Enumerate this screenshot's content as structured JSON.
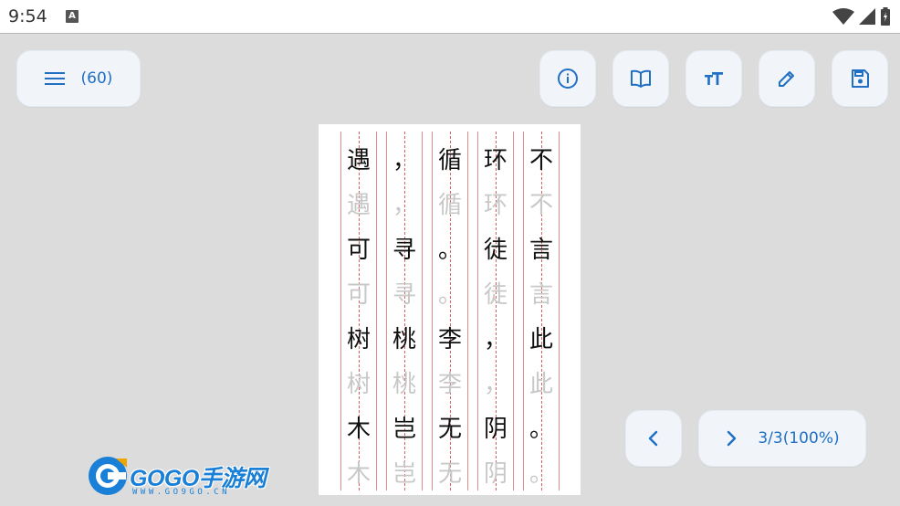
{
  "status_bar": {
    "time": "9:54",
    "notification_icon_letter": "A",
    "icons": [
      "wifi-icon",
      "signal-icon",
      "battery-icon"
    ]
  },
  "toolbar": {
    "menu_count": "(60)",
    "icons": [
      "info-icon",
      "book-icon",
      "font-size-icon",
      "edit-pencil-icon",
      "save-icon"
    ],
    "accent_color": "#1f6fc4"
  },
  "pager": {
    "prev_icon": "chevron-left-icon",
    "next_icon": "chevron-right-icon",
    "progress": "3/3(100%)"
  },
  "worksheet": {
    "columns": [
      {
        "chars": [
          "遇",
          "可",
          "树",
          "木"
        ]
      },
      {
        "chars": [
          "，",
          "寻",
          "桃",
          "岂"
        ]
      },
      {
        "chars": [
          "循",
          "。",
          "李",
          "无"
        ]
      },
      {
        "chars": [
          "环",
          "徒",
          "，",
          "阴"
        ]
      },
      {
        "chars": [
          "不",
          "言",
          "此",
          "。"
        ]
      }
    ]
  },
  "watermark": {
    "brand": "GOGO手游网",
    "url": "WWW.GO9GO.CN"
  }
}
